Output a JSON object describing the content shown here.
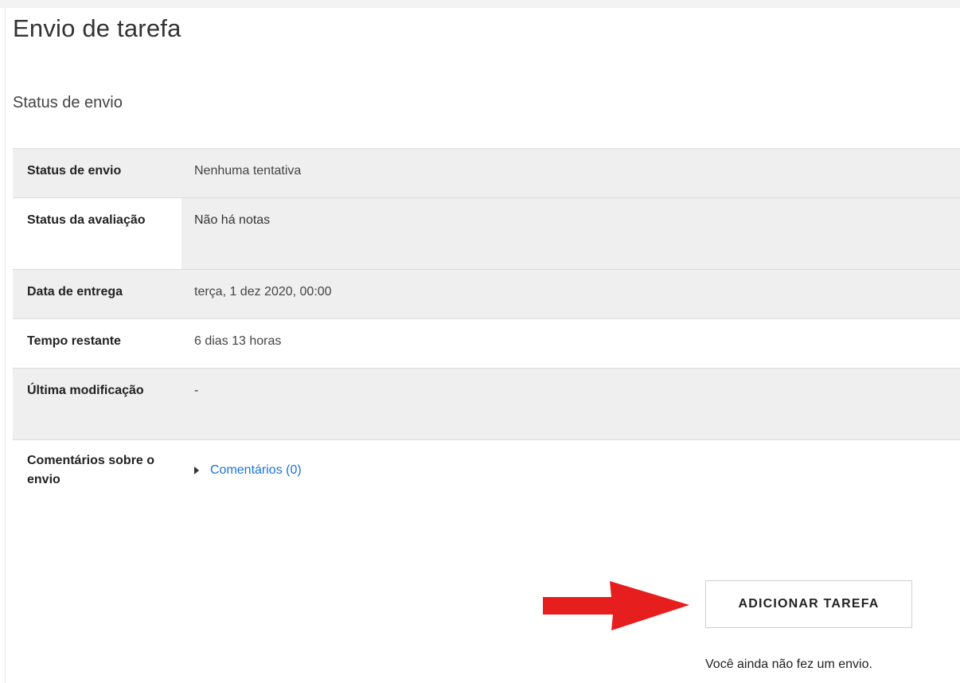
{
  "page": {
    "title": "Envio de tarefa",
    "section_title": "Status de envio"
  },
  "table": {
    "rows": [
      {
        "label": "Status de envio",
        "value": "Nenhuma tentativa"
      },
      {
        "label": "Status da avaliação",
        "value": "Não há notas"
      },
      {
        "label": "Data de entrega",
        "value": "terça, 1 dez 2020, 00:00"
      },
      {
        "label": "Tempo restante",
        "value": "6 dias 13 horas"
      },
      {
        "label": "Última modificação",
        "value": "-"
      },
      {
        "label": "Comentários sobre o envio",
        "value": "Comentários (0)"
      }
    ]
  },
  "actions": {
    "add_button_label": "ADICIONAR TAREFA",
    "no_submission_text": "Você ainda não fez um envio."
  },
  "colors": {
    "link": "#1a73d9",
    "arrow": "#e61e1e",
    "row_grey": "#efefef"
  },
  "icons": {
    "expand": "caret-right-icon",
    "pointer": "red-arrow-icon"
  }
}
